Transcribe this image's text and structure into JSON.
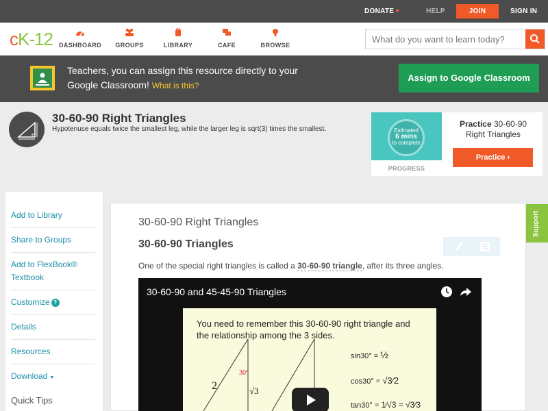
{
  "topbar": {
    "donate": "DONATE",
    "help": "HELP",
    "join": "JOIN",
    "signin": "SIGN IN"
  },
  "logo": "ck-12",
  "nav": {
    "items": [
      {
        "label": "DASHBOARD",
        "icon": "speedometer-icon"
      },
      {
        "label": "GROUPS",
        "icon": "people-icon"
      },
      {
        "label": "LIBRARY",
        "icon": "backpack-icon"
      },
      {
        "label": "CAFE",
        "icon": "chat-bubbles-icon"
      },
      {
        "label": "BROWSE",
        "icon": "lightbulb-icon"
      }
    ],
    "search_placeholder": "What do you want to learn today?"
  },
  "banner": {
    "message": "Teachers, you can assign this resource directly to your Google Classroom!",
    "what_link": "What is this?",
    "assign_button": "Assign to Google Classroom"
  },
  "header": {
    "title": "30-60-90 Right Triangles",
    "subtitle": "Hypotenuse equals twice the smallest leg, while the larger leg is sqrt(3) times the smallest.",
    "progress": {
      "estimated": "Estimated",
      "mins": "6 mins",
      "to_complete": "to complete",
      "label": "PROGRESS"
    },
    "practice_prefix": "Practice",
    "practice_title": "30-60-90 Right Triangles",
    "practice_button": "Practice"
  },
  "sidebar": {
    "items": [
      {
        "label": "Add to Library"
      },
      {
        "label": "Share to Groups"
      },
      {
        "label": "Add to FlexBook® Textbook"
      },
      {
        "label": "Customize"
      },
      {
        "label": "Details"
      },
      {
        "label": "Resources"
      },
      {
        "label": "Download"
      }
    ],
    "quick_tips": "Quick Tips"
  },
  "main": {
    "page_title": "30-60-90 Right Triangles",
    "section_title": "30-60-90 Triangles",
    "para_before": "One of the special right triangles is called a ",
    "para_term": "30-60-90 triangle",
    "para_after": ", after its three angles.",
    "video": {
      "title": "30-60-90 and 45-45-90 Triangles",
      "slide_text": "You need to remember this 30-60-90 right triangle and the relationship among the 3 sides.",
      "eq_sin": "sin30° =",
      "eq_cos": "cos30° =",
      "eq_tan": "tan30° ="
    }
  },
  "support_tab": "Support",
  "colors": {
    "brand_orange": "#f05a28",
    "brand_green": "#8bc53f",
    "google_green": "#1f9d55",
    "dark_bar": "#4b4b4b",
    "link_teal": "#1b8ea8"
  }
}
